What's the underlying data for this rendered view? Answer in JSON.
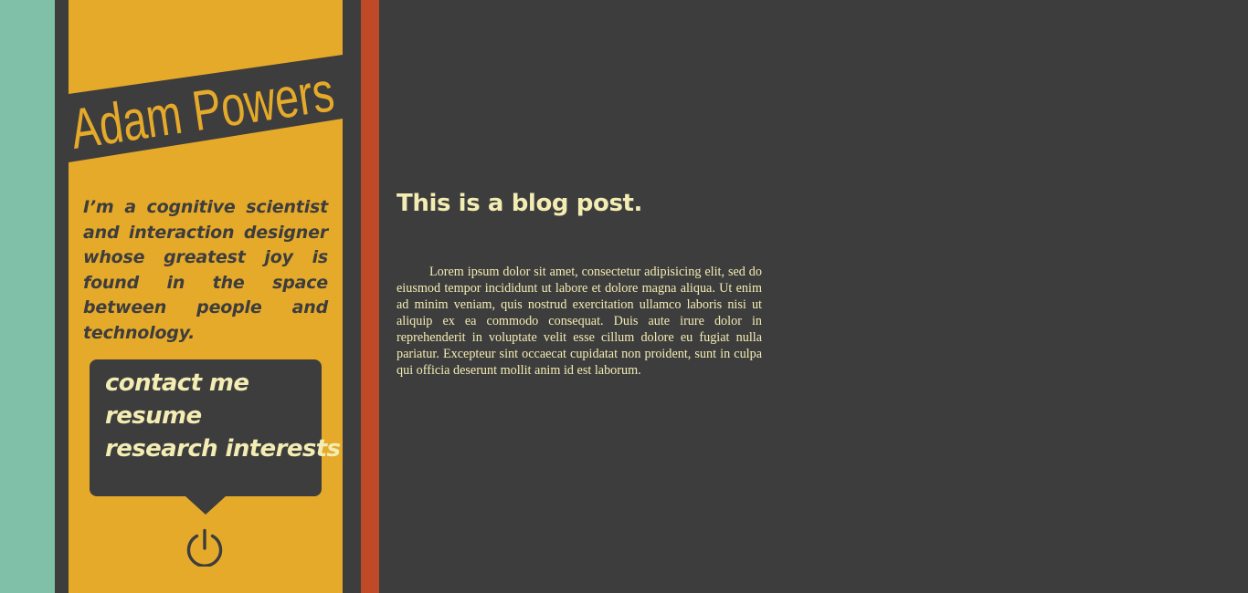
{
  "colors": {
    "teal_stripe": "#80bfa8",
    "sidebar_yellow": "#e6aa2a",
    "red_stripe": "#be4a28",
    "background_dark": "#3d3d3d",
    "text_cream": "#f3ecb3"
  },
  "sidebar": {
    "name": "Adam Powers",
    "bio": "I’m a cognitive scientist and interaction designer whose greatest joy is found in the space between people and technology.",
    "menu": {
      "items": [
        {
          "label": "contact me"
        },
        {
          "label": "resume"
        },
        {
          "label": "research interests"
        }
      ]
    },
    "power_icon": "power-icon"
  },
  "post": {
    "title": "This is a blog post.",
    "body": "Lorem ipsum dolor sit amet, consectetur adipisicing elit, sed do eiusmod tempor incididunt ut labore et dolore magna aliqua. Ut enim ad minim veniam, quis nostrud exercitation ullamco laboris nisi ut aliquip ex ea commodo consequat. Duis aute irure dolor in reprehenderit in voluptate velit esse cillum dolore eu fugiat nulla pariatur. Excepteur sint occaecat cupidatat non proident, sunt in culpa qui officia deserunt mollit anim id est laborum."
  }
}
